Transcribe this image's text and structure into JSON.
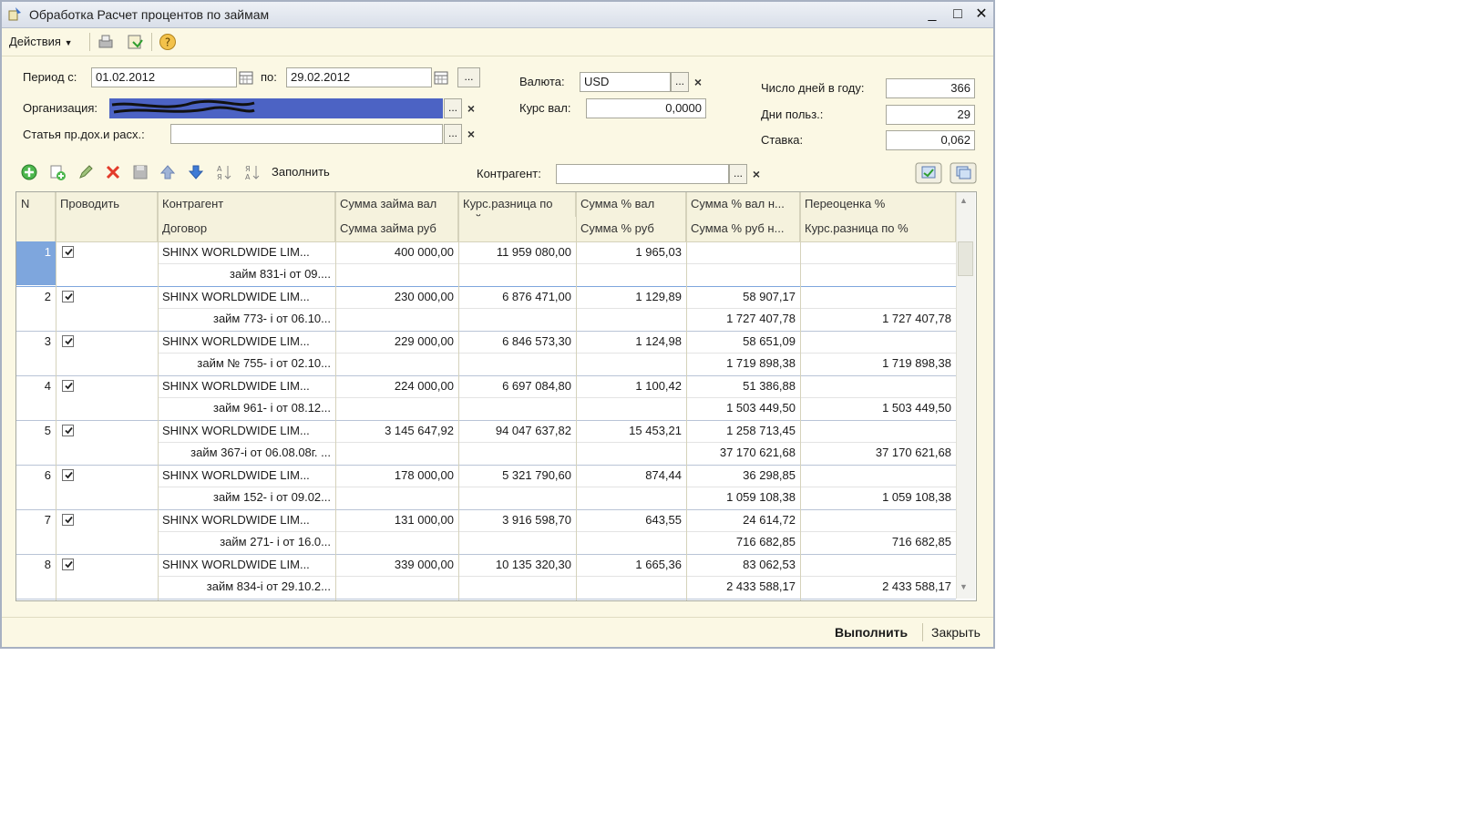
{
  "window": {
    "title": "Обработка  Расчет процентов по займам",
    "minimize_label": "_",
    "maximize_label": "□",
    "close_label": "✕"
  },
  "menubar": {
    "actions_label": "Действия"
  },
  "form": {
    "period_from_label": "Период с:",
    "period_from_value": "01.02.2012",
    "period_to_label": "по:",
    "period_to_value": "29.02.2012",
    "period_btn_label": "...",
    "org_label": "Организация:",
    "article_label": "Статья пр.дох.и расх.:",
    "article_value": "",
    "currency_label": "Валюта:",
    "currency_value": "USD",
    "rate_label": "Курс вал:",
    "rate_value": "0,0000",
    "days_year_label": "Число дней в году:",
    "days_year_value": "366",
    "days_use_label": "Дни польз.:",
    "days_use_value": "29",
    "rate_pct_label": "Ставка:",
    "rate_pct_value": "0,062",
    "select_btn_label": "...",
    "clear_btn_label": "×"
  },
  "toolbar": {
    "fill_label": "Заполнить",
    "counterparty_label": "Контрагент:",
    "counterparty_value": ""
  },
  "table": {
    "header_row1": [
      "N",
      "Проводить",
      "Контрагент",
      "Сумма займа вал",
      "Курс.разница по займу",
      "Сумма % вал",
      "Сумма % вал н...",
      "Переоценка %"
    ],
    "header_row2": [
      "Договор",
      "Сумма займа руб",
      "Сумма % руб",
      "Сумма % руб н...",
      "Курс.разница по %"
    ],
    "rows": [
      {
        "n": "1",
        "contr": "SHINX WORLDWIDE LIM...",
        "loan_val": "400 000,00",
        "kr_loan": "11 959 080,00",
        "pct_val": "1 965,03",
        "pct_val_n": "",
        "pereoc": "",
        "dog": "займ    831-i от 09....",
        "loan_rub": "",
        "pct_rub": "",
        "pct_rub_n": "",
        "kr_pct": ""
      },
      {
        "n": "2",
        "contr": "SHINX WORLDWIDE LIM...",
        "loan_val": "230 000,00",
        "kr_loan": "6 876 471,00",
        "pct_val": "1 129,89",
        "pct_val_n": "58 907,17",
        "pereoc": "",
        "dog": "займ    773- i от 06.10...",
        "loan_rub": "",
        "pct_rub": "",
        "pct_rub_n": "1 727 407,78",
        "kr_pct": "1 727 407,78"
      },
      {
        "n": "3",
        "contr": "SHINX WORLDWIDE LIM...",
        "loan_val": "229 000,00",
        "kr_loan": "6 846 573,30",
        "pct_val": "1 124,98",
        "pct_val_n": "58 651,09",
        "pereoc": "",
        "dog": "займ № 755- i от 02.10...",
        "loan_rub": "",
        "pct_rub": "",
        "pct_rub_n": "1 719 898,38",
        "kr_pct": "1 719 898,38"
      },
      {
        "n": "4",
        "contr": "SHINX WORLDWIDE LIM...",
        "loan_val": "224 000,00",
        "kr_loan": "6 697 084,80",
        "pct_val": "1 100,42",
        "pct_val_n": "51 386,88",
        "pereoc": "",
        "dog": "займ  961- i от 08.12...",
        "loan_rub": "",
        "pct_rub": "",
        "pct_rub_n": "1 503 449,50",
        "kr_pct": "1 503 449,50"
      },
      {
        "n": "5",
        "contr": "SHINX WORLDWIDE LIM...",
        "loan_val": "3 145 647,92",
        "kr_loan": "94 047 637,82",
        "pct_val": "15 453,21",
        "pct_val_n": "1 258 713,45",
        "pereoc": "",
        "dog": "займ 367-i от 06.08.08г. ...",
        "loan_rub": "",
        "pct_rub": "",
        "pct_rub_n": "37 170 621,68",
        "kr_pct": "37 170 621,68"
      },
      {
        "n": "6",
        "contr": "SHINX WORLDWIDE LIM...",
        "loan_val": "178 000,00",
        "kr_loan": "5 321 790,60",
        "pct_val": "874,44",
        "pct_val_n": "36 298,85",
        "pereoc": "",
        "dog": "займ  152- i от 09.02...",
        "loan_rub": "",
        "pct_rub": "",
        "pct_rub_n": "1 059 108,38",
        "kr_pct": "1 059 108,38"
      },
      {
        "n": "7",
        "contr": "SHINX WORLDWIDE LIM...",
        "loan_val": "131 000,00",
        "kr_loan": "3 916 598,70",
        "pct_val": "643,55",
        "pct_val_n": "24 614,72",
        "pereoc": "",
        "dog": "займ  271- i от 16.0...",
        "loan_rub": "",
        "pct_rub": "",
        "pct_rub_n": "716 682,85",
        "kr_pct": "716 682,85"
      },
      {
        "n": "8",
        "contr": "SHINX WORLDWIDE LIM...",
        "loan_val": "339 000,00",
        "kr_loan": "10 135 320,30",
        "pct_val": "1 665,36",
        "pct_val_n": "83 062,53",
        "pereoc": "",
        "dog": "займ  834-i от 29.10.2...",
        "loan_rub": "",
        "pct_rub": "",
        "pct_rub_n": "2 433 588,17",
        "kr_pct": "2 433 588,17"
      }
    ]
  },
  "footer": {
    "execute_label": "Выполнить",
    "close_label": "Закрыть"
  },
  "colors": {
    "window_bg": "#fbf8e4",
    "selection": "#7ea6dd",
    "org_fill": "#4c63c4"
  }
}
